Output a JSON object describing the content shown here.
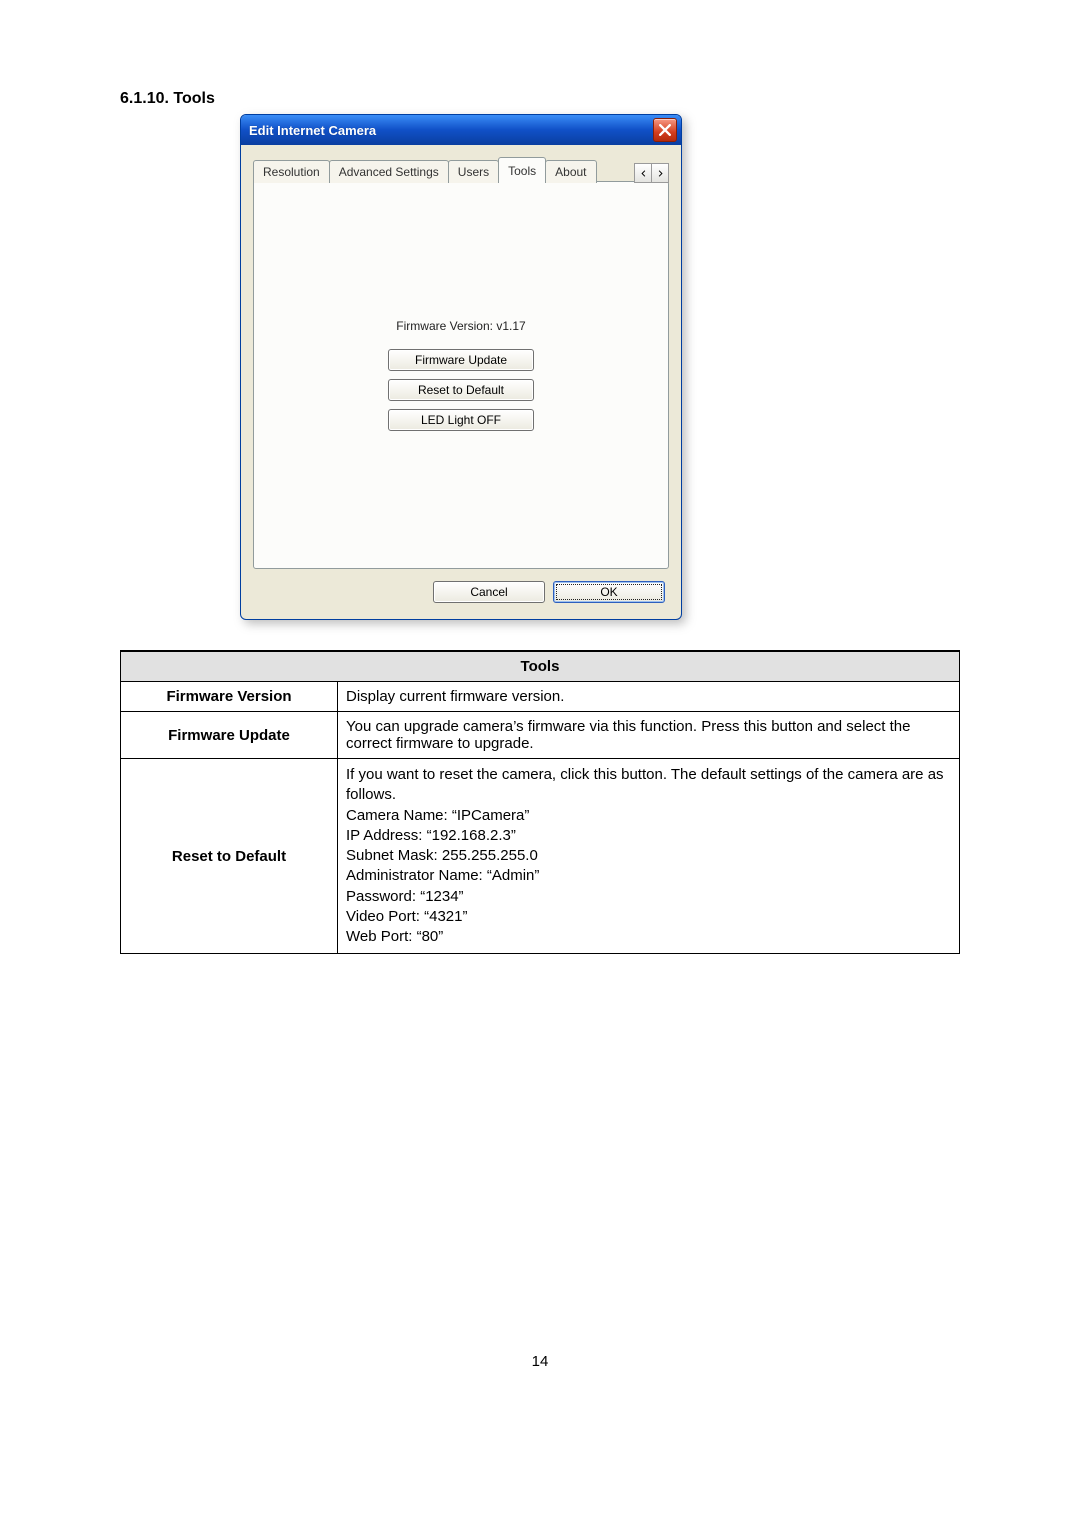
{
  "section_heading": "6.1.10.  Tools",
  "dialog": {
    "title": "Edit Internet Camera",
    "tabs": {
      "resolution": "Resolution",
      "advanced": "Advanced Settings",
      "users": "Users",
      "tools": "Tools",
      "about": "About"
    },
    "firmware_version_label": "Firmware Version: v1.17",
    "buttons": {
      "firmware_update": "Firmware Update",
      "reset_default": "Reset to Default",
      "led_off": "LED Light OFF",
      "cancel": "Cancel",
      "ok": "OK"
    }
  },
  "table": {
    "header": "Tools",
    "rows": {
      "firmware_version": {
        "label": "Firmware Version",
        "value": "Display current firmware version."
      },
      "firmware_update": {
        "label": "Firmware Update",
        "value": "You can upgrade camera’s firmware via this function. Press this button and select the correct firmware to upgrade."
      },
      "reset_default": {
        "label": "Reset to Default",
        "value": "If you want to reset the camera, click this button. The default settings of the camera are as follows.\nCamera Name: “IPCamera”\nIP Address: “192.168.2.3”\nSubnet Mask: 255.255.255.0\nAdministrator Name: “Admin”\nPassword: “1234”\nVideo Port: “4321”\nWeb Port: “80”"
      }
    }
  },
  "page_number": "14"
}
